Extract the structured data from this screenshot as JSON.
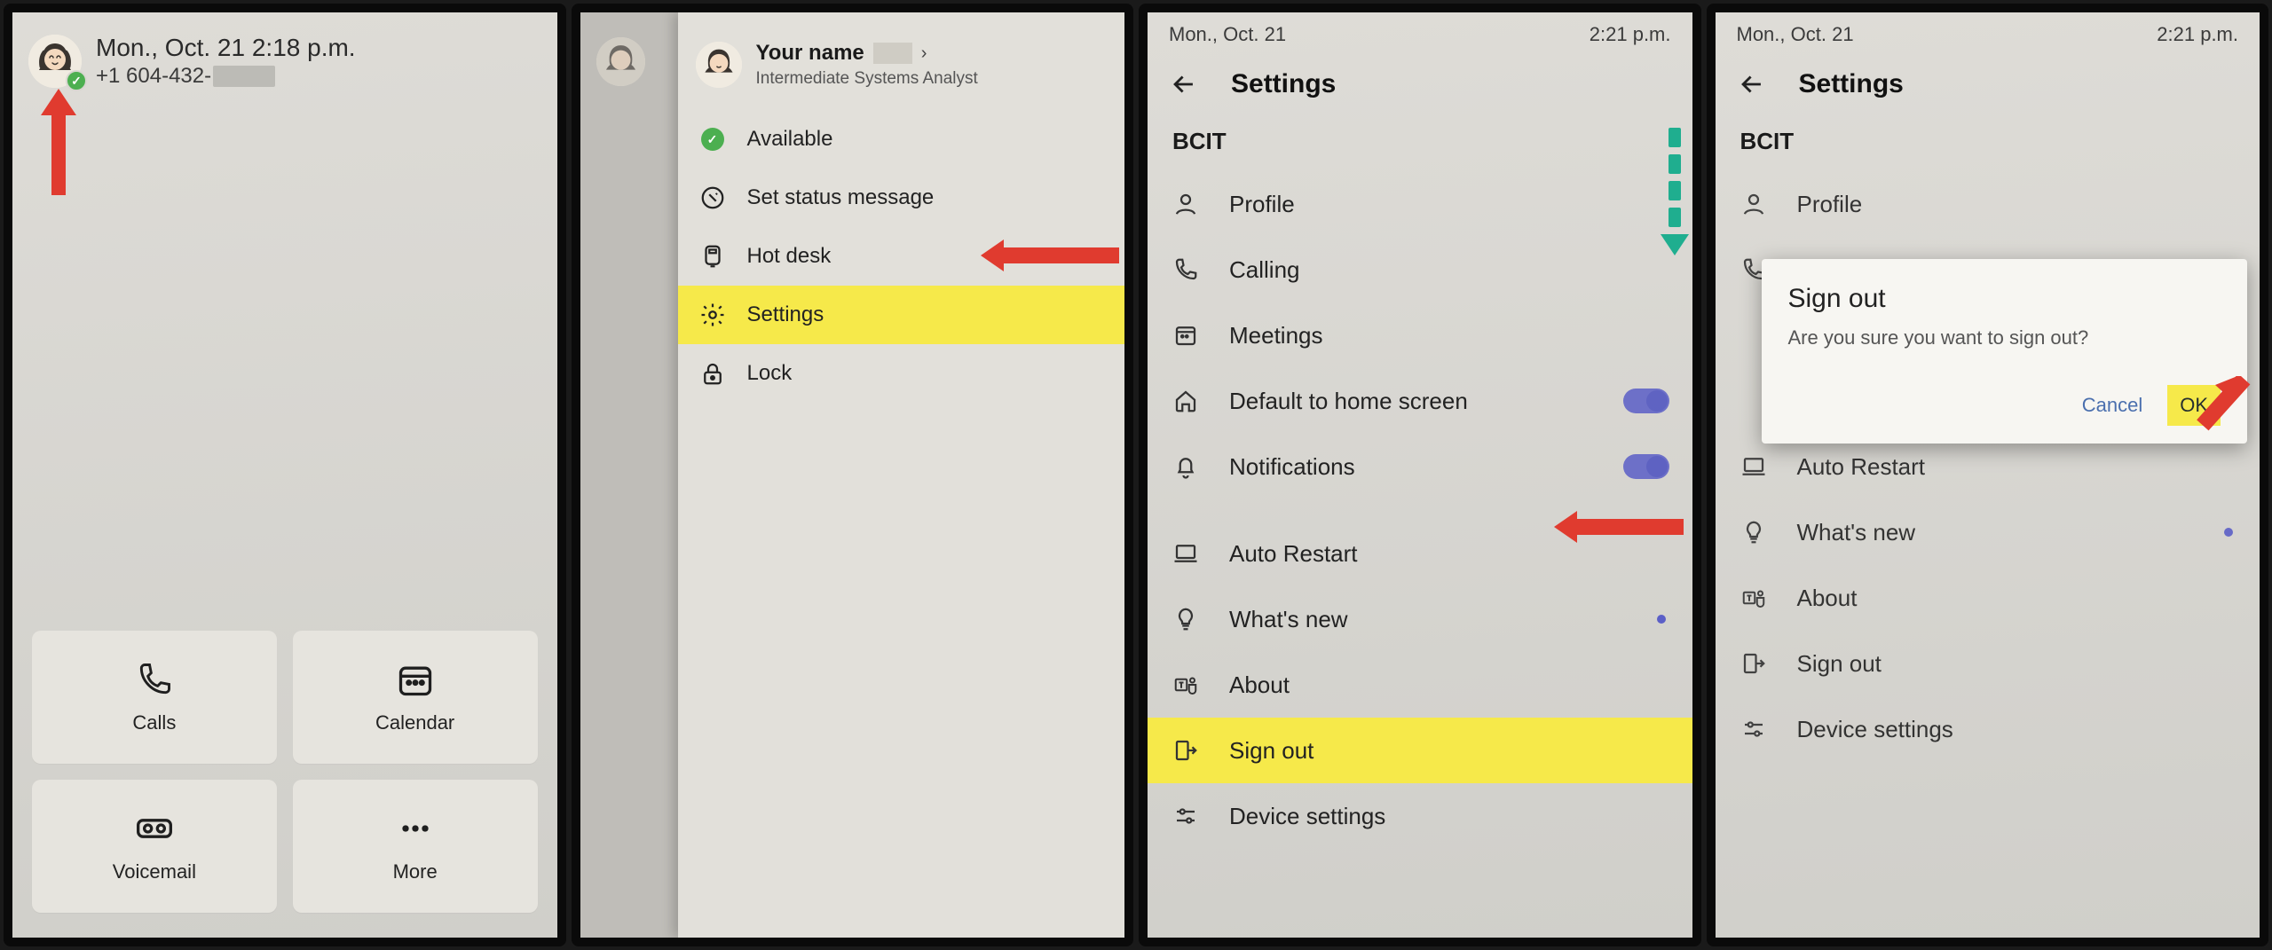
{
  "panel1": {
    "datetime": "Mon., Oct. 21 2:18 p.m.",
    "phone_prefix": "+1 604-432-",
    "tiles": {
      "calls": "Calls",
      "calendar": "Calendar",
      "voicemail": "Voicemail",
      "more": "More"
    }
  },
  "panel2": {
    "user_name": "Your name",
    "user_role": "Intermediate Systems Analyst",
    "items": {
      "available": "Available",
      "status_msg": "Set status message",
      "hot_desk": "Hot desk",
      "settings": "Settings",
      "lock": "Lock"
    }
  },
  "panel3": {
    "status_date": "Mon., Oct. 21",
    "status_time": "2:21 p.m.",
    "title": "Settings",
    "section": "BCIT",
    "items": {
      "profile": "Profile",
      "calling": "Calling",
      "meetings": "Meetings",
      "home_default": "Default to home screen",
      "notifications": "Notifications",
      "auto_restart": "Auto Restart",
      "whats_new": "What's new",
      "about": "About",
      "sign_out": "Sign out",
      "device_settings": "Device settings"
    }
  },
  "panel4": {
    "status_date": "Mon., Oct. 21",
    "status_time": "2:21 p.m.",
    "title": "Settings",
    "section": "BCIT",
    "dialog": {
      "title": "Sign out",
      "message": "Are you sure you want to sign out?",
      "cancel": "Cancel",
      "ok": "OK"
    },
    "items": {
      "profile": "Profile",
      "calling": "Calling",
      "auto_restart": "Auto Restart",
      "whats_new": "What's new",
      "about": "About",
      "sign_out": "Sign out",
      "device_settings": "Device settings"
    }
  }
}
